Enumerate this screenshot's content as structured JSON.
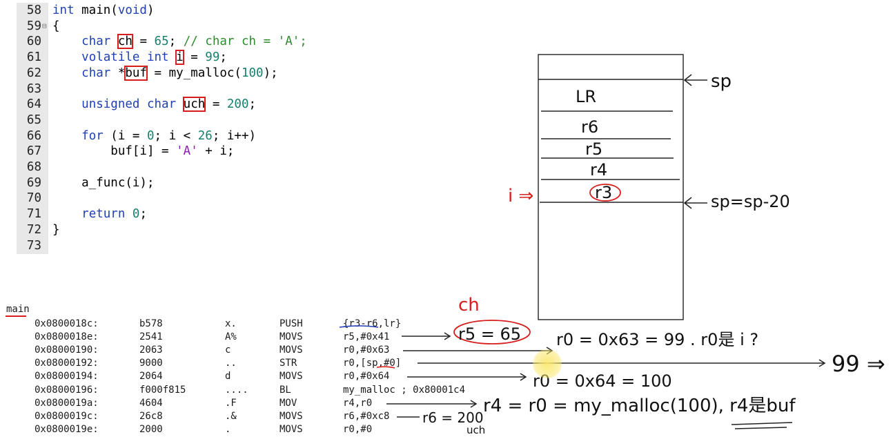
{
  "editor": {
    "lines": [
      {
        "num": "58",
        "fold": "",
        "tokens": [
          {
            "t": "int",
            "c": "kw"
          },
          {
            "t": " main("
          },
          {
            "t": "void",
            "c": "kw"
          },
          {
            "t": ")"
          }
        ]
      },
      {
        "num": "59",
        "fold": "⊟",
        "tokens": [
          {
            "t": "{"
          }
        ]
      },
      {
        "num": "60",
        "fold": "",
        "tokens": [
          {
            "t": "    "
          },
          {
            "t": "char",
            "c": "kw"
          },
          {
            "t": " "
          },
          {
            "t": "ch",
            "hl": true
          },
          {
            "t": " = "
          },
          {
            "t": "65",
            "c": "num"
          },
          {
            "t": "; "
          },
          {
            "t": "// char ch = 'A';",
            "c": "cmt"
          }
        ]
      },
      {
        "num": "61",
        "fold": "",
        "tokens": [
          {
            "t": "    "
          },
          {
            "t": "volatile int",
            "c": "kw"
          },
          {
            "t": " "
          },
          {
            "t": "i",
            "hl": true
          },
          {
            "t": " = "
          },
          {
            "t": "99",
            "c": "num"
          },
          {
            "t": ";"
          }
        ]
      },
      {
        "num": "62",
        "fold": "",
        "tokens": [
          {
            "t": "    "
          },
          {
            "t": "char",
            "c": "kw"
          },
          {
            "t": " *"
          },
          {
            "t": "buf",
            "hl": true
          },
          {
            "t": " = my_malloc("
          },
          {
            "t": "100",
            "c": "num"
          },
          {
            "t": ");"
          }
        ]
      },
      {
        "num": "63",
        "fold": "",
        "tokens": []
      },
      {
        "num": "64",
        "fold": "",
        "tokens": [
          {
            "t": "    "
          },
          {
            "t": "unsigned char",
            "c": "kw"
          },
          {
            "t": " "
          },
          {
            "t": "uch",
            "hl": true
          },
          {
            "t": " = "
          },
          {
            "t": "200",
            "c": "num"
          },
          {
            "t": ";"
          }
        ]
      },
      {
        "num": "65",
        "fold": "",
        "tokens": []
      },
      {
        "num": "66",
        "fold": "",
        "tokens": [
          {
            "t": "    "
          },
          {
            "t": "for",
            "c": "kw"
          },
          {
            "t": " (i = "
          },
          {
            "t": "0",
            "c": "num"
          },
          {
            "t": "; i < "
          },
          {
            "t": "26",
            "c": "num"
          },
          {
            "t": "; i++)"
          }
        ]
      },
      {
        "num": "67",
        "fold": "",
        "tokens": [
          {
            "t": "        buf[i] = "
          },
          {
            "t": "'A'",
            "c": "str"
          },
          {
            "t": " + i;"
          }
        ]
      },
      {
        "num": "68",
        "fold": "",
        "tokens": []
      },
      {
        "num": "69",
        "fold": "",
        "tokens": [
          {
            "t": "    a_func(i);"
          }
        ]
      },
      {
        "num": "70",
        "fold": "",
        "tokens": []
      },
      {
        "num": "71",
        "fold": "",
        "tokens": [
          {
            "t": "    "
          },
          {
            "t": "return",
            "c": "kw"
          },
          {
            "t": " "
          },
          {
            "t": "0",
            "c": "num"
          },
          {
            "t": ";"
          }
        ]
      },
      {
        "num": "72",
        "fold": "",
        "tokens": [
          {
            "t": "}"
          }
        ]
      },
      {
        "num": "73",
        "fold": "",
        "tokens": []
      }
    ]
  },
  "disasm": {
    "function": "main",
    "rows": [
      {
        "addr": "0x0800018c:",
        "hex": "b578",
        "ascii": "x.",
        "op": "PUSH",
        "args": "{r3-r6,lr}"
      },
      {
        "addr": "0x0800018e:",
        "hex": "2541",
        "ascii": "A%",
        "op": "MOVS",
        "args": "r5,#0x41"
      },
      {
        "addr": "0x08000190:",
        "hex": "2063",
        "ascii": "c",
        "op": "MOVS",
        "args": "r0,#0x63"
      },
      {
        "addr": "0x08000192:",
        "hex": "9000",
        "ascii": "..",
        "op": "STR",
        "args": "r0,[sp,#0]"
      },
      {
        "addr": "0x08000194:",
        "hex": "2064",
        "ascii": "d",
        "op": "MOVS",
        "args": "r0,#0x64"
      },
      {
        "addr": "0x08000196:",
        "hex": "f000f815",
        "ascii": "....",
        "op": "BL",
        "args": "my_malloc ; 0x80001c4"
      },
      {
        "addr": "0x0800019a:",
        "hex": "4604",
        "ascii": ".F",
        "op": "MOV",
        "args": "r4,r0"
      },
      {
        "addr": "0x0800019c:",
        "hex": "26c8",
        "ascii": ".&",
        "op": "MOVS",
        "args": "r6,#0xc8"
      },
      {
        "addr": "0x0800019e:",
        "hex": "2000",
        "ascii": ".",
        "op": "MOVS",
        "args": "r0,#0"
      }
    ]
  },
  "stack": {
    "slots": [
      "LR",
      "r6",
      "r5",
      "r4",
      "r3"
    ],
    "sp_label": "sp",
    "sp_new_label": "sp=sp-20",
    "i_label": "i ⇒"
  },
  "notes": {
    "ch": "ch",
    "r5": "r5 = 65",
    "r0_i": "r0 = 0x63 = 99 .  r0是 i ?",
    "store": "99 ⇒",
    "r0_100": "r0 = 0x64 = 100",
    "r6": "r6 = 200",
    "uch": "uch",
    "r4": "r4 = r0 = my_malloc(100),  r4是buf"
  },
  "colors": {
    "keyword": "#1f3fb5",
    "number": "#17806d",
    "string": "#8a1ab0",
    "comment": "#2e8b2e",
    "highlight_box": "#d81c1c",
    "ink": "#111111",
    "cursor": "#f5e36a"
  }
}
